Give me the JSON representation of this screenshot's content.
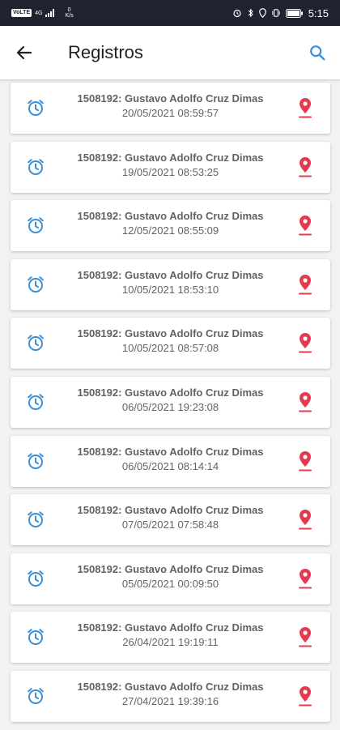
{
  "status_bar": {
    "carrier_badge": "VoLTE",
    "signal_label": "4G",
    "speed_value": "0",
    "speed_unit": "K/s",
    "time": "5:15"
  },
  "header": {
    "title": "Registros"
  },
  "colors": {
    "accent_blue": "#3a8fd6",
    "pin_red": "#e53950",
    "text_gray": "#5f6368"
  },
  "records": [
    {
      "name": "1508192: Gustavo Adolfo Cruz Dimas",
      "datetime": "20/05/2021 08:59:57"
    },
    {
      "name": "1508192: Gustavo Adolfo Cruz Dimas",
      "datetime": "19/05/2021 08:53:25"
    },
    {
      "name": "1508192: Gustavo Adolfo Cruz Dimas",
      "datetime": "12/05/2021 08:55:09"
    },
    {
      "name": "1508192: Gustavo Adolfo Cruz Dimas",
      "datetime": "10/05/2021 18:53:10"
    },
    {
      "name": "1508192: Gustavo Adolfo Cruz Dimas",
      "datetime": "10/05/2021 08:57:08"
    },
    {
      "name": "1508192: Gustavo Adolfo Cruz Dimas",
      "datetime": "06/05/2021 19:23:08"
    },
    {
      "name": "1508192: Gustavo Adolfo Cruz Dimas",
      "datetime": "06/05/2021 08:14:14"
    },
    {
      "name": "1508192: Gustavo Adolfo Cruz Dimas",
      "datetime": "07/05/2021 07:58:48"
    },
    {
      "name": "1508192: Gustavo Adolfo Cruz Dimas",
      "datetime": "05/05/2021 00:09:50"
    },
    {
      "name": "1508192: Gustavo Adolfo Cruz Dimas",
      "datetime": "26/04/2021 19:19:11"
    },
    {
      "name": "1508192: Gustavo Adolfo Cruz Dimas",
      "datetime": "27/04/2021 19:39:16"
    }
  ]
}
